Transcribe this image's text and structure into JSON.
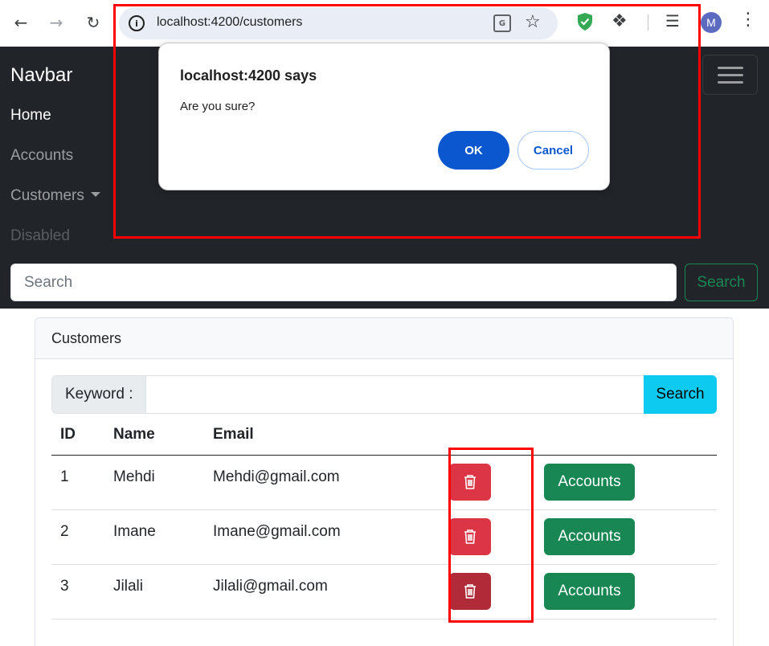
{
  "browser": {
    "url": "localhost:4200/customers",
    "avatar_letter": "M",
    "icons": [
      "back-icon",
      "forward-icon",
      "reload-icon",
      "site-info-icon",
      "translate-icon",
      "star-icon",
      "shield-extension-icon",
      "puzzle-icon",
      "media-queue-icon",
      "kebab-menu-icon"
    ]
  },
  "navbar": {
    "brand": "Navbar",
    "links": [
      {
        "label": "Home",
        "state": "active"
      },
      {
        "label": "Accounts",
        "state": "normal"
      },
      {
        "label": "Customers",
        "state": "dropdown"
      },
      {
        "label": "Disabled",
        "state": "disabled"
      }
    ],
    "search_placeholder": "Search",
    "search_button": "Search"
  },
  "card": {
    "header": "Customers",
    "keyword_label": "Keyword :",
    "keyword_value": "",
    "search_button": "Search",
    "columns": [
      "ID",
      "Name",
      "Email"
    ],
    "rows": [
      {
        "id": "1",
        "name": "Mehdi",
        "email": "Mehdi@gmail.com",
        "accounts_label": "Accounts"
      },
      {
        "id": "2",
        "name": "Imane",
        "email": "Imane@gmail.com",
        "accounts_label": "Accounts"
      },
      {
        "id": "3",
        "name": "Jilali",
        "email": "Jilali@gmail.com",
        "accounts_label": "Accounts"
      }
    ]
  },
  "dialog": {
    "title": "localhost:4200 says",
    "message": "Are you sure?",
    "ok_label": "OK",
    "cancel_label": "Cancel"
  },
  "colors": {
    "navbar_bg": "#212529",
    "danger": "#dc3545",
    "success": "#198754",
    "info": "#0dcaf0",
    "dialog_primary": "#0b57d0",
    "annotation": "#ff0000"
  }
}
